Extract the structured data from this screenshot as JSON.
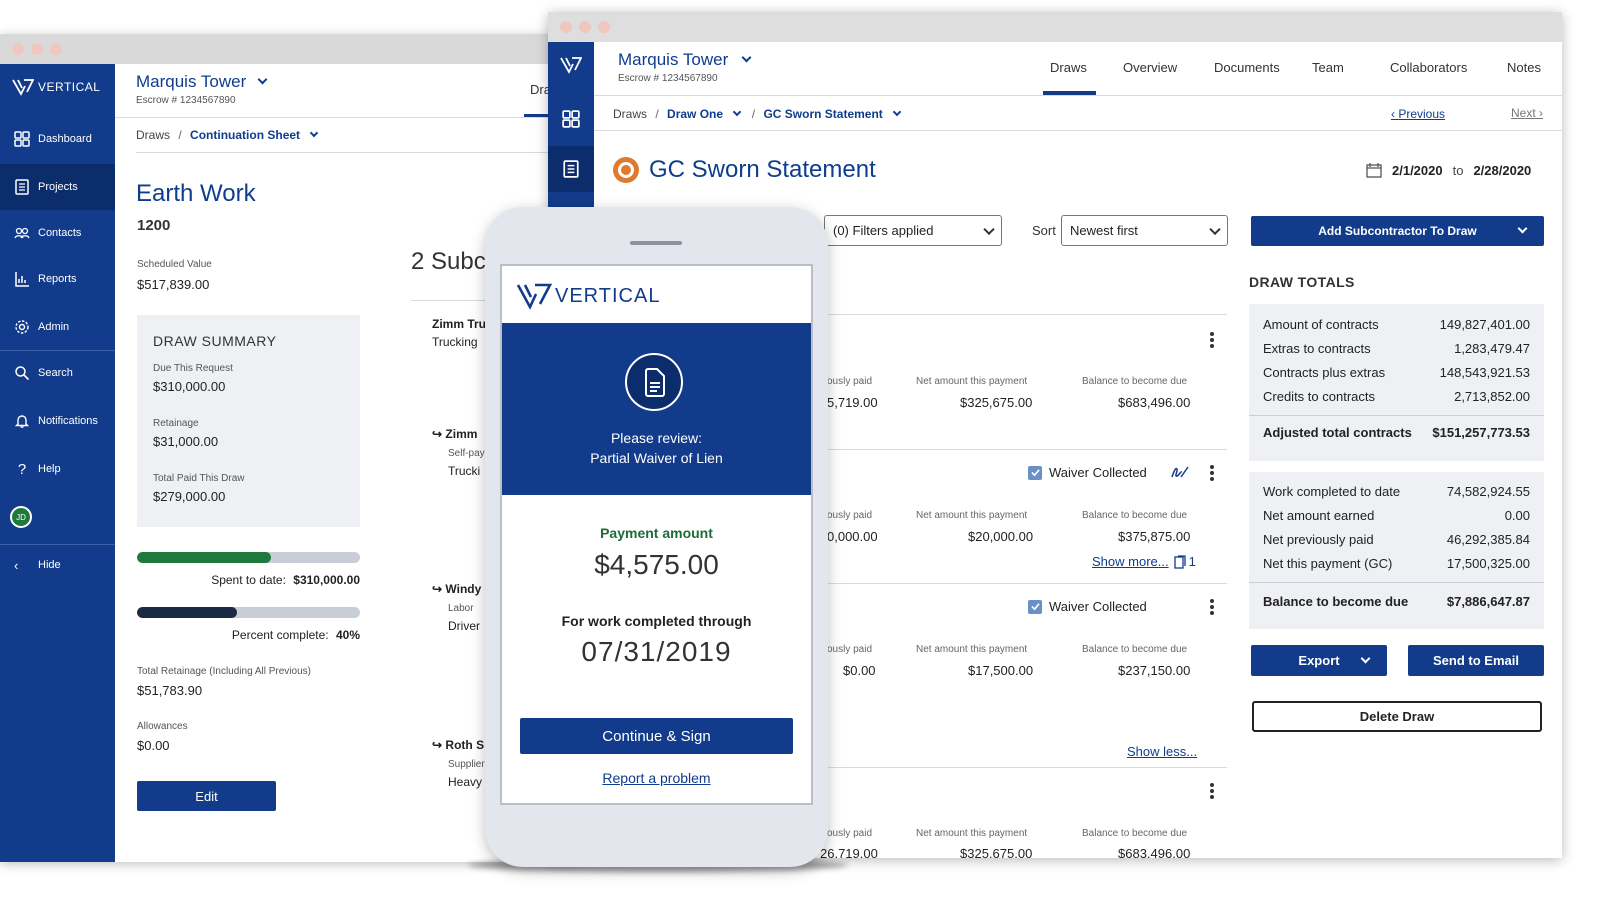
{
  "back_window": {
    "sidebar": {
      "logo": "VERTICAL",
      "items": [
        {
          "label": "Dashboard",
          "icon": "dashboard-icon"
        },
        {
          "label": "Projects",
          "icon": "projects-icon"
        },
        {
          "label": "Contacts",
          "icon": "contacts-icon"
        },
        {
          "label": "Reports",
          "icon": "reports-icon"
        },
        {
          "label": "Admin",
          "icon": "gear-icon"
        },
        {
          "label": "Search",
          "icon": "search-icon"
        },
        {
          "label": "Notifications",
          "icon": "bell-icon"
        },
        {
          "label": "Help",
          "icon": "help-icon"
        }
      ],
      "avatar": "JD",
      "hide_label": "Hide"
    },
    "header": {
      "project": "Marquis Tower",
      "escrow": "Escrow # 1234567890",
      "tab_partial": "Dra"
    },
    "breadcrumb": {
      "root": "Draws",
      "current": "Continuation Sheet"
    },
    "title": "Earth Work",
    "code": "1200",
    "scheduled_label": "Scheduled Value",
    "scheduled_value": "$517,839.00",
    "summary": {
      "heading": "DRAW SUMMARY",
      "due_label": "Due This Request",
      "due_value": "$310,000.00",
      "retainage_label": "Retainage",
      "retainage_value": "$31,000.00",
      "paid_label": "Total Paid This Draw",
      "paid_value": "$279,000.00"
    },
    "spent_label": "Spent to date:",
    "spent_value": "$310,000.00",
    "spent_fraction": 0.6,
    "percent_label": "Percent complete:",
    "percent_value": "40%",
    "percent_fraction": 0.45,
    "total_retainage_label": "Total Retainage (Including All Previous)",
    "total_retainage_value": "$51,783.90",
    "allowances_label": "Allowances",
    "allowances_value": "$0.00",
    "edit_label": "Edit",
    "subs_heading": "2 Subc",
    "subs": [
      {
        "name": "Zimm Tru",
        "type": "",
        "desc": "Trucking"
      },
      {
        "name": "Zimm",
        "type": "Self-pay",
        "desc": "Trucki"
      },
      {
        "name": "Windy",
        "type": "Labor",
        "desc": "Driver"
      },
      {
        "name": "Roth S",
        "type": "Supplier",
        "desc": "Heavy"
      }
    ]
  },
  "front_window": {
    "header": {
      "project": "Marquis Tower",
      "escrow": "Escrow # 1234567890"
    },
    "tabs": [
      "Draws",
      "Overview",
      "Documents",
      "Team",
      "Collaborators",
      "Notes"
    ],
    "breadcrumb": {
      "root": "Draws",
      "draw": "Draw One",
      "current": "GC Sworn Statement"
    },
    "prev_label": "‹ Previous",
    "next_label": "Next ›",
    "title": "GC Sworn Statement",
    "date_from": "2/1/2020",
    "date_to_label": "to",
    "date_to": "2/28/2020",
    "filter_value": "(0) Filters applied",
    "sort_label": "Sort",
    "sort_value": "Newest first",
    "add_button": "Add Subcontractor To Draw",
    "col_prev": "ously paid",
    "col_net": "Net amount this payment",
    "col_bal": "Balance to become due",
    "rows": [
      {
        "prev": "5,719.00",
        "net": "$325,675.00",
        "bal": "$683,496.00"
      },
      {
        "prev": "0,000.00",
        "net": "$20,000.00",
        "bal": "$375,875.00"
      },
      {
        "prev": "$0.00",
        "net": "$17,500.00",
        "bal": "$237,150.00"
      },
      {
        "prev": "26,719.00",
        "net": "$325,675.00",
        "bal": "$683,496.00"
      }
    ],
    "waiver_label": "Waiver Collected",
    "show_more": "Show more...",
    "attach_count": "1",
    "show_less": "Show less...",
    "totals": {
      "heading": "DRAW TOTALS",
      "group1": [
        {
          "label": "Amount of contracts",
          "value": "149,827,401.00"
        },
        {
          "label": "Extras to contracts",
          "value": "1,283,479.47"
        },
        {
          "label": "Contracts plus extras",
          "value": "148,543,921.53"
        },
        {
          "label": "Credits to contracts",
          "value": "2,713,852.00"
        }
      ],
      "adjusted_label": "Adjusted total contracts",
      "adjusted_value": "$151,257,773.53",
      "group2": [
        {
          "label": "Work completed to date",
          "value": "74,582,924.55"
        },
        {
          "label": "Net amount earned",
          "value": "0.00"
        },
        {
          "label": "Net previously paid",
          "value": "46,292,385.84"
        },
        {
          "label": "Net this payment (GC)",
          "value": "17,500,325.00"
        }
      ],
      "balance_label": "Balance to become due",
      "balance_value": "$7,886,647.87"
    },
    "export_label": "Export",
    "email_label": "Send to Email",
    "delete_label": "Delete Draw"
  },
  "phone": {
    "logo": "VERTICAL",
    "review_line1": "Please review:",
    "review_line2": "Partial Waiver of Lien",
    "payment_label": "Payment amount",
    "payment_value": "$4,575.00",
    "through_label": "For work completed through",
    "through_date": "07/31/2019",
    "continue_label": "Continue & Sign",
    "report_label": "Report a problem"
  },
  "colors": {
    "navy": "#123c8b",
    "green": "#1e7a3c",
    "accent_orange": "#e07a2e"
  }
}
